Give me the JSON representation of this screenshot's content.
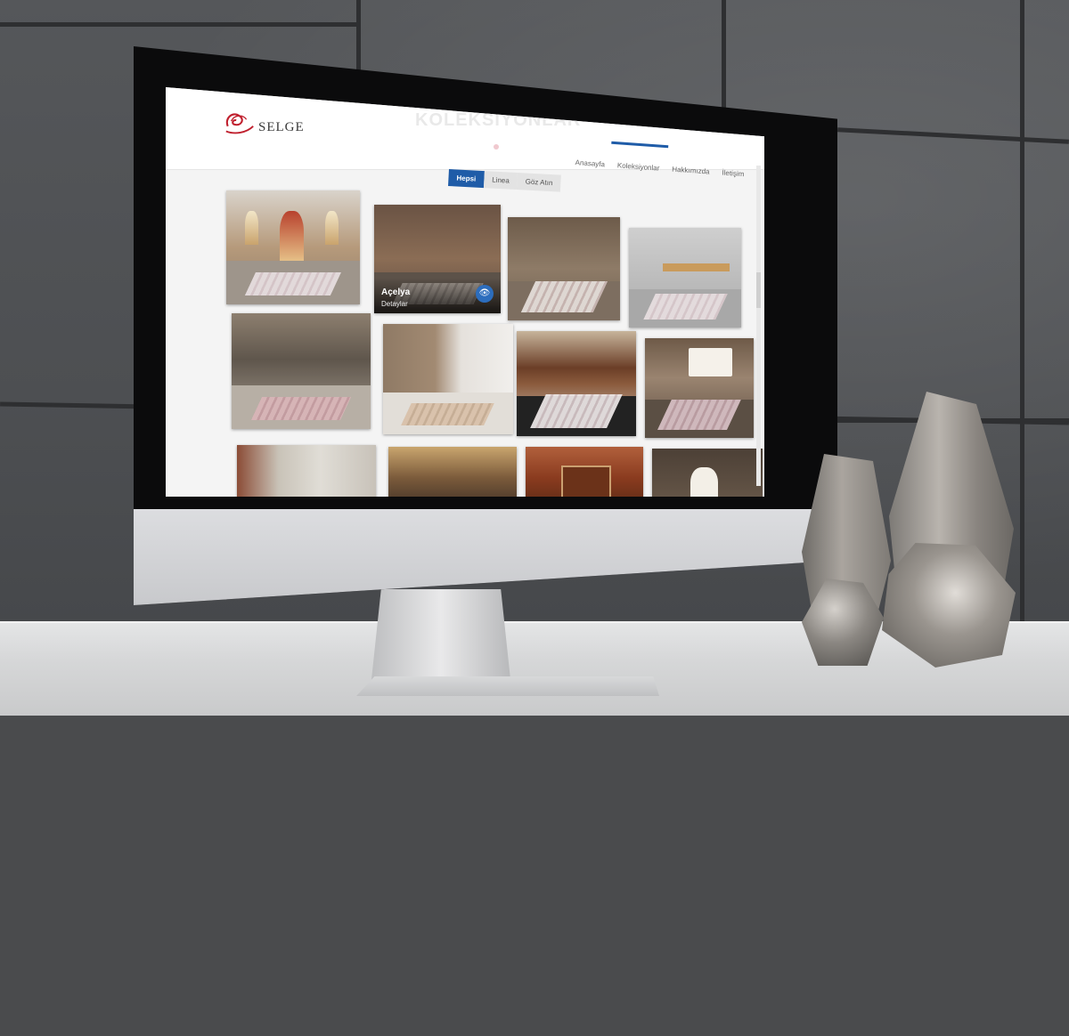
{
  "site": {
    "logo_text": "SELGE",
    "page_title": "KOLEKSİYONLAR",
    "nav": [
      {
        "label": "Anasayfa"
      },
      {
        "label": "Koleksiyonlar",
        "active": true
      },
      {
        "label": "Hakkımızda"
      },
      {
        "label": "İletişim"
      }
    ],
    "filters": [
      {
        "label": "Hepsi",
        "active": true
      },
      {
        "label": "Linea"
      },
      {
        "label": "Göz Atın"
      }
    ],
    "hover_card": {
      "title": "Açelya",
      "subtitle": "Detaylar",
      "icon": "eye-icon"
    }
  },
  "colors": {
    "accent": "#1f5ca8",
    "logo_red": "#c0202e",
    "eye_button": "#2c6dbd"
  },
  "device": {
    "apple_logo": ""
  }
}
